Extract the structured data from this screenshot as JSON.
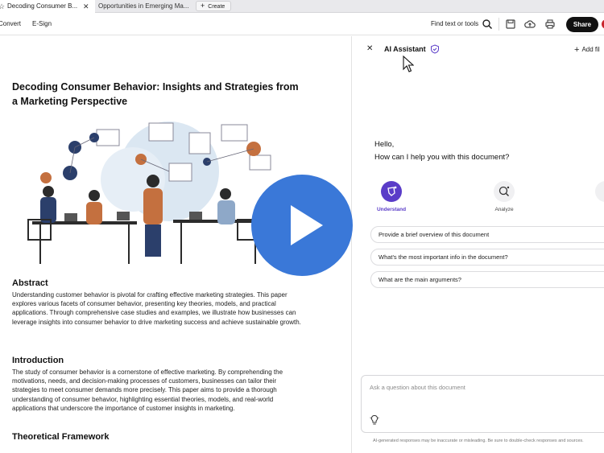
{
  "tabs": {
    "active_label": "Decoding Consumer B...",
    "active_close": "✕",
    "second_label": "Opportunities in Emerging Ma...",
    "new_tab_label": "Create"
  },
  "toolbar": {
    "convert": "Convert",
    "esign": "E-Sign",
    "find": "Find text or tools",
    "share": "Share"
  },
  "document": {
    "title": "Decoding Consumer Behavior: Insights and Strategies from a Marketing Perspective",
    "abstract_heading": "Abstract",
    "abstract_text": "Understanding customer behavior is pivotal for crafting effective marketing strategies. This paper explores various facets of consumer behavior, presenting key theories, models, and practical applications. Through comprehensive case studies and examples, we illustrate how businesses can leverage insights into consumer behavior to drive marketing success and achieve sustainable growth.",
    "intro_heading": "Introduction",
    "intro_text": "The study of consumer behavior is a cornerstone of effective marketing. By comprehending the motivations, needs, and decision-making processes of customers, businesses can tailor their strategies to meet consumer demands more precisely. This paper aims to provide a thorough understanding of consumer behavior, highlighting essential theories, models, and real-world applications that underscore the importance of customer insights in marketing.",
    "framework_heading": "Theoretical Framework"
  },
  "assistant": {
    "close": "✕",
    "title": "AI Assistant",
    "add_files": "Add fil",
    "greeting_line1": "Hello,",
    "greeting_line2": "How can I help you with this document?",
    "modes": [
      {
        "label": "Understand"
      },
      {
        "label": "Analyze"
      }
    ],
    "suggestions": [
      "Provide a brief overview of this document",
      "What's the most important info in the document?",
      "What are the main arguments?"
    ],
    "input_placeholder": "Ask a question about this document",
    "disclaimer": "AI-generated responses may be inaccurate or misleading. Be sure to double-check responses and sources."
  },
  "colors": {
    "accent_purple": "#5a3cc8",
    "play_blue": "#3a78d8",
    "share_bg": "#111111"
  }
}
